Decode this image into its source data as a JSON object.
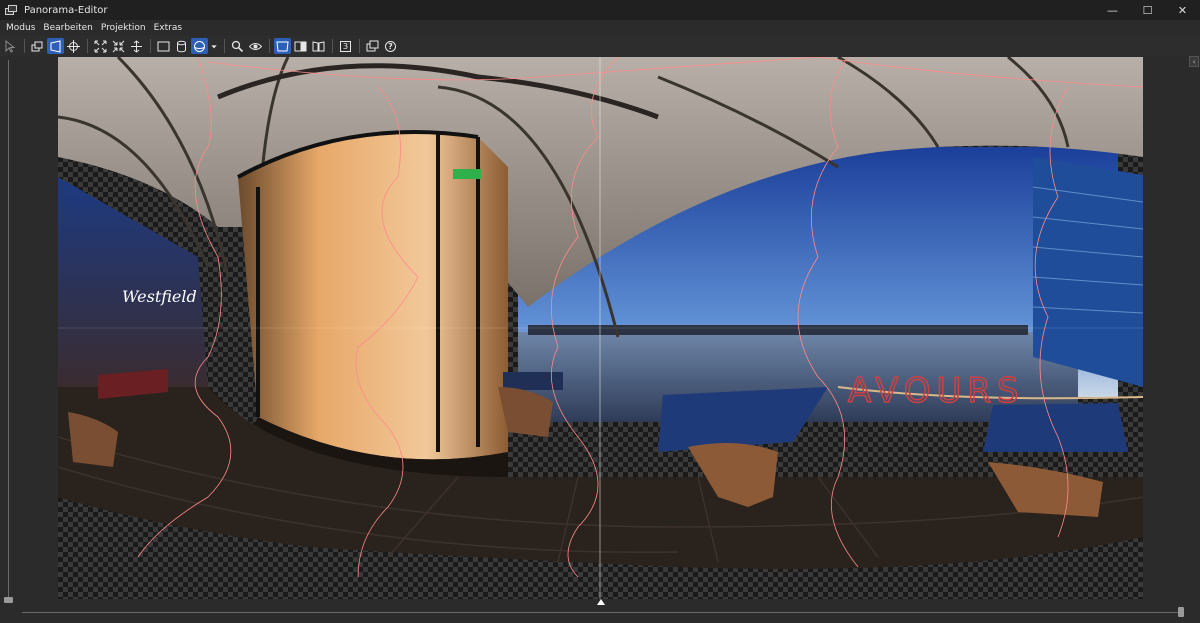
{
  "window": {
    "title": "Panorama-Editor",
    "controls": {
      "minimize": "—",
      "maximize": "☐",
      "close": "✕"
    }
  },
  "menu": {
    "items": [
      {
        "label": "Modus"
      },
      {
        "label": "Bearbeiten"
      },
      {
        "label": "Projektion"
      },
      {
        "label": "Extras"
      }
    ]
  },
  "toolbar": {
    "number_button": "3",
    "help_button": "?"
  },
  "canvas": {
    "signs": {
      "westfield": "Westfield",
      "reflection": "AVOURS"
    }
  },
  "colors": {
    "accent": "#2e5fb8",
    "seam": "#ff8a8a",
    "sky_top": "#1f4fb0",
    "sky_bottom": "#9ec2e8"
  }
}
